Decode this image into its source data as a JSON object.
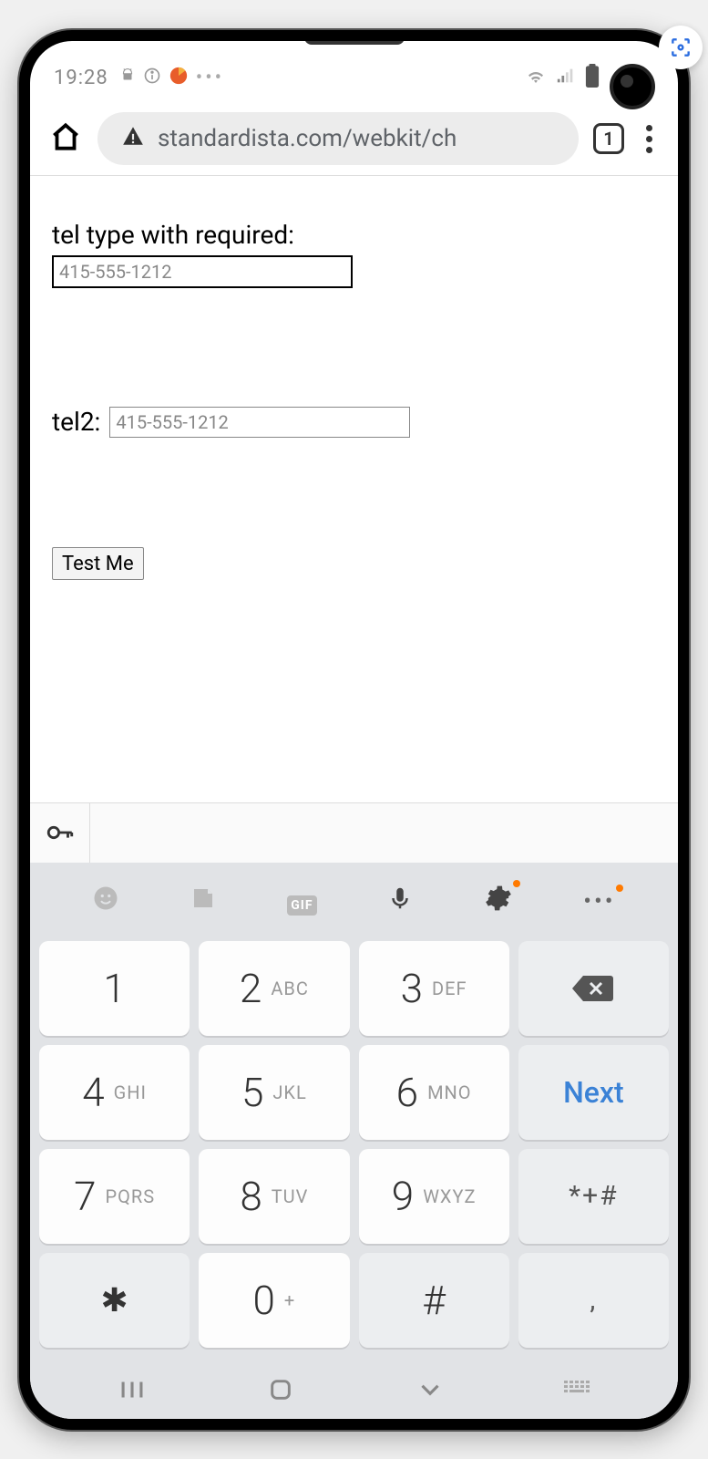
{
  "statusbar": {
    "time": "19:28"
  },
  "urlbar": {
    "url": "standardista.com/webkit/ch",
    "tab_count": "1"
  },
  "form": {
    "tel1_label": "tel type with required:",
    "tel1_placeholder": "415-555-1212",
    "tel2_label": "tel2:",
    "tel2_placeholder": "415-555-1212",
    "button_label": "Test Me"
  },
  "keyboard": {
    "toolbar": {
      "gif": "GIF"
    },
    "keys": [
      {
        "num": "1",
        "lab": ""
      },
      {
        "num": "2",
        "lab": "ABC"
      },
      {
        "num": "3",
        "lab": "DEF"
      },
      {
        "type": "backspace"
      },
      {
        "num": "4",
        "lab": "GHI"
      },
      {
        "num": "5",
        "lab": "JKL"
      },
      {
        "num": "6",
        "lab": "MNO"
      },
      {
        "type": "next",
        "lab": "Next"
      },
      {
        "num": "7",
        "lab": "PQRS"
      },
      {
        "num": "8",
        "lab": "TUV"
      },
      {
        "num": "9",
        "lab": "WXYZ"
      },
      {
        "type": "sym",
        "lab": "*+#"
      },
      {
        "type": "star",
        "lab": "✱"
      },
      {
        "num": "0",
        "lab": "+"
      },
      {
        "type": "hash",
        "lab": "#"
      },
      {
        "type": "comma",
        "lab": ","
      }
    ]
  }
}
